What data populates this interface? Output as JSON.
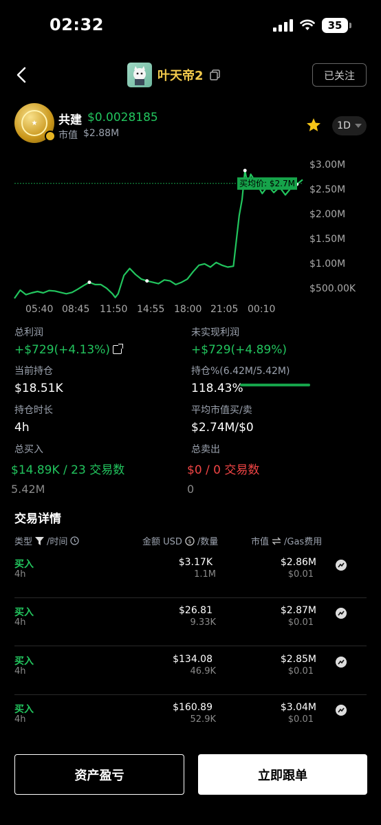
{
  "status_bar": {
    "time": "02:32",
    "battery": "35"
  },
  "nav": {
    "name": "叶天帝2",
    "follow_label": "已关注"
  },
  "token": {
    "name": "共建",
    "price": "$0.0028185",
    "mcap_label": "市值",
    "mcap_value": "$2.88M",
    "timeframe": "1D"
  },
  "chart_data": {
    "type": "line",
    "x_ticks": [
      "05:40",
      "08:45",
      "11:50",
      "14:55",
      "18:00",
      "21:05",
      "00:10"
    ],
    "y_ticks": [
      "$3.00M",
      "$2.50M",
      "$2.00M",
      "$1.50M",
      "$1.00M",
      "$500.00K"
    ],
    "avg_price_label": "买均价: $2.7M",
    "avg_price": 2.7,
    "unit": "M",
    "ylim": [
      0.2,
      3.1
    ],
    "x_range": [
      0,
      100
    ],
    "grid": false,
    "series": [
      {
        "values": [
          [
            0,
            0.2
          ],
          [
            2,
            0.38
          ],
          [
            4,
            0.28
          ],
          [
            6,
            0.32
          ],
          [
            8,
            0.35
          ],
          [
            10,
            0.32
          ],
          [
            12,
            0.37
          ],
          [
            14,
            0.36
          ],
          [
            16,
            0.33
          ],
          [
            18,
            0.3
          ],
          [
            20,
            0.33
          ],
          [
            22,
            0.4
          ],
          [
            24,
            0.48
          ],
          [
            26,
            0.55
          ],
          [
            28,
            0.5
          ],
          [
            30,
            0.5
          ],
          [
            32,
            0.42
          ],
          [
            34,
            0.3
          ],
          [
            35,
            0.22
          ],
          [
            36,
            0.3
          ],
          [
            38,
            0.7
          ],
          [
            40,
            0.85
          ],
          [
            42,
            0.72
          ],
          [
            44,
            0.62
          ],
          [
            46,
            0.58
          ],
          [
            48,
            0.55
          ],
          [
            50,
            0.52
          ],
          [
            52,
            0.6
          ],
          [
            54,
            0.58
          ],
          [
            56,
            0.5
          ],
          [
            58,
            0.55
          ],
          [
            60,
            0.62
          ],
          [
            62,
            0.78
          ],
          [
            64,
            0.92
          ],
          [
            66,
            0.95
          ],
          [
            68,
            0.88
          ],
          [
            70,
            0.98
          ],
          [
            72,
            0.92
          ],
          [
            74,
            0.88
          ],
          [
            76,
            0.9
          ],
          [
            77,
            1.45
          ],
          [
            78,
            2.0
          ],
          [
            79,
            2.35
          ],
          [
            80,
            2.98
          ],
          [
            81,
            2.65
          ],
          [
            82,
            2.9
          ],
          [
            84,
            2.7
          ],
          [
            86,
            2.48
          ],
          [
            88,
            2.65
          ],
          [
            90,
            2.5
          ],
          [
            92,
            2.62
          ],
          [
            94,
            2.45
          ],
          [
            96,
            2.6
          ],
          [
            98,
            2.68
          ],
          [
            100,
            2.78
          ]
        ],
        "color": "#22c55e"
      }
    ]
  },
  "stats": {
    "total_profit": {
      "label": "总利润",
      "value": "+$729(+4.13%)"
    },
    "unrealized": {
      "label": "未实现利润",
      "value": "+$729(+4.89%)"
    },
    "holding": {
      "label": "当前持仓",
      "value": "$18.51K"
    },
    "holding_pct": {
      "label": "持仓%(6.42M/5.42M)",
      "value": "118.43%",
      "fill": 1.0
    },
    "duration": {
      "label": "持仓时长",
      "value": "4h"
    },
    "avg_mcap": {
      "label": "平均市值买/卖",
      "value": "$2.74M/$0"
    },
    "total_buy": {
      "label": "总买入",
      "value": "$14.89K / 23 交易数",
      "sub": "5.42M"
    },
    "total_sell": {
      "label": "总卖出",
      "value": "$0 / 0 交易数",
      "sub": "0"
    }
  },
  "trades": {
    "title": "交易详情",
    "headers": {
      "type": "类型",
      "time": "/时间",
      "amount": "金额 USD",
      "qty": "/数量",
      "mcap": "市值",
      "gas": "/Gas费用"
    },
    "rows": [
      {
        "type": "买入",
        "time": "4h",
        "amount": "$3.17K",
        "qty": "1.1M",
        "mcap": "$2.86M",
        "gas": "$0.01"
      },
      {
        "type": "买入",
        "time": "4h",
        "amount": "$26.81",
        "qty": "9.33K",
        "mcap": "$2.87M",
        "gas": "$0.01"
      },
      {
        "type": "买入",
        "time": "4h",
        "amount": "$134.08",
        "qty": "46.9K",
        "mcap": "$2.85M",
        "gas": "$0.01"
      },
      {
        "type": "买入",
        "time": "4h",
        "amount": "$160.89",
        "qty": "52.9K",
        "mcap": "$3.04M",
        "gas": "$0.01"
      }
    ]
  },
  "buttons": {
    "pnl": "资产盈亏",
    "copy_trade": "立即跟单"
  }
}
